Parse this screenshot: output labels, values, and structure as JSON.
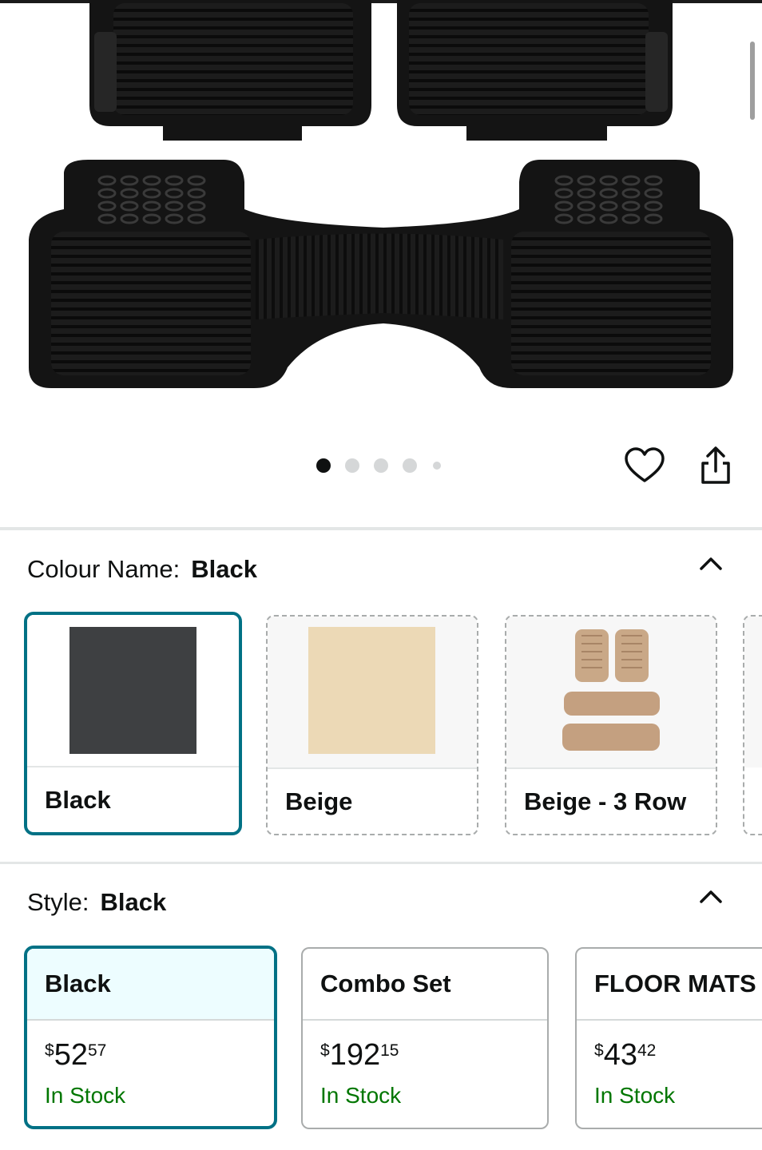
{
  "gallery": {
    "image_alt": "Black rubber car floor mats",
    "dot_count": 5,
    "active_dot": 1
  },
  "actions": {
    "wishlist_icon": "heart-icon",
    "share_icon": "share-icon"
  },
  "colour": {
    "label": "Colour Name:",
    "selected": "Black",
    "options": [
      {
        "label": "Black",
        "color": "#3e4042"
      },
      {
        "label": "Beige",
        "color": "#ecd9b6"
      },
      {
        "label": "Beige - 3 Row",
        "color": "#c9a887"
      }
    ]
  },
  "style": {
    "label": "Style:",
    "selected": "Black",
    "options": [
      {
        "name": "Black",
        "currency": "$",
        "whole": "52",
        "fraction": "57",
        "stock": "In Stock"
      },
      {
        "name": "Combo Set",
        "currency": "$",
        "whole": "192",
        "fraction": "15",
        "stock": "In Stock"
      },
      {
        "name": "FLOOR MATS",
        "currency": "$",
        "whole": "43",
        "fraction": "42",
        "stock": "In Stock"
      }
    ]
  },
  "colors": {
    "accent": "#007185",
    "in_stock": "#007600",
    "selected_header": "#edfdff"
  }
}
